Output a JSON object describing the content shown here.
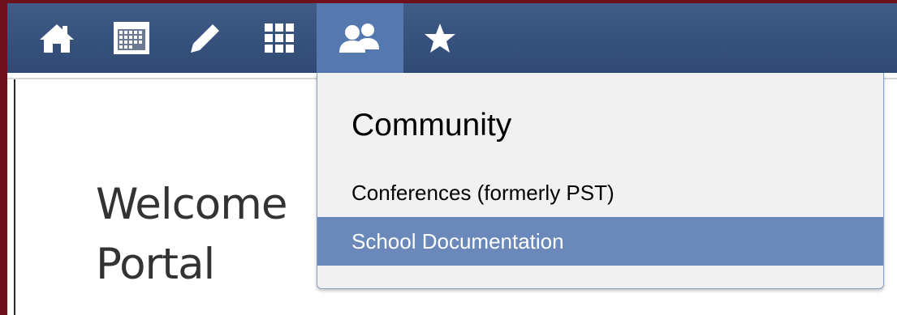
{
  "navbar": {
    "items": [
      {
        "icon": "home-icon"
      },
      {
        "icon": "calendar-icon"
      },
      {
        "icon": "pencil-icon"
      },
      {
        "icon": "grid-icon"
      },
      {
        "icon": "community-icon",
        "active": true
      },
      {
        "icon": "star-icon"
      }
    ]
  },
  "page": {
    "welcome_line1": "Welcome",
    "welcome_line2": "Portal"
  },
  "dropdown": {
    "title": "Community",
    "items": [
      {
        "label": "Conferences (formerly PST)"
      },
      {
        "label": "School Documentation",
        "selected": true
      }
    ]
  },
  "colors": {
    "frame": "#6e0f1e",
    "navbar": "#34507a",
    "active_tab": "#5579ae",
    "selected_item": "#6a88b9"
  }
}
